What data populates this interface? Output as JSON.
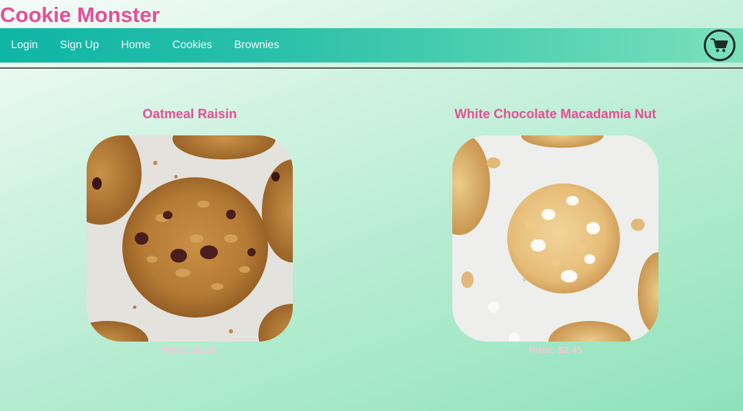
{
  "header": {
    "site_title": "Cookie Monster"
  },
  "nav": {
    "items": [
      {
        "label": "Login"
      },
      {
        "label": "Sign Up"
      },
      {
        "label": "Home"
      },
      {
        "label": "Cookies"
      },
      {
        "label": "Brownies"
      }
    ],
    "cart_icon": "shopping-cart-icon"
  },
  "products": [
    {
      "name": "Oatmeal Raisin",
      "price": "Price: $1.65",
      "image_icon": "oatmeal-raisin-cookie-image"
    },
    {
      "name": "White Chocolate Macadamia Nut",
      "price": "Price: $2.45",
      "image_icon": "white-chocolate-macadamia-cookie-image"
    }
  ],
  "colors": {
    "accent_pink": "#e64f97",
    "nav_teal": "#0fb5a5",
    "price_pink": "#f5c6d8"
  }
}
